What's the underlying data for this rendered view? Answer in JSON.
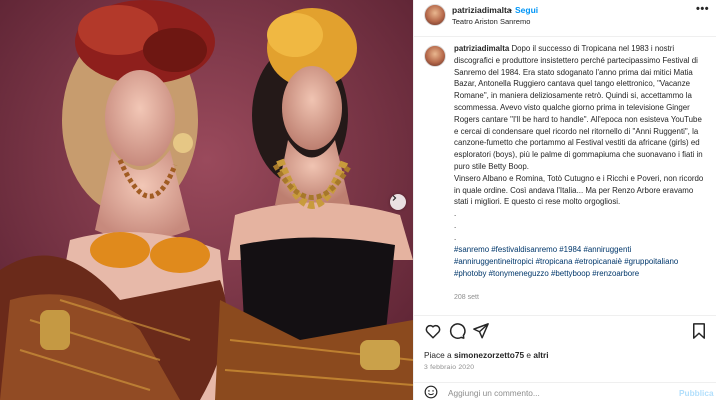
{
  "post": {
    "username": "patriziadimalta",
    "dot": "•",
    "follow_label": "Segui",
    "location": "Teatro Ariston Sanremo",
    "more_icon": "more-horizontal-icon",
    "caption_text": "Dopo il successo di Tropicana nel 1983 i nostri discografici e produttore insistettero perché partecipassimo Festival di Sanremo del 1984. Era stato sdoganato l'anno prima dai mitici Matia Bazar, Antonella Ruggiero cantava quel tango elettronico, \"Vacanze Romane\", in maniera deliziosamente retrò. Quindi si, accettammo la scommessa. Avevo visto qualche giorno prima in televisione Ginger Rogers cantare \"I'll be hard to handle\". All'epoca non esisteva YouTube e cercai di condensare quel ricordo nel ritornello di \"Anni Ruggenti\", la canzone-fumetto che portammo al Festival vestiti da africane (girls) ed esploratori (boys), più le palme di gommapiuma che suonavano i fiati in puro stile Betty Boop.\nVinsero Albano e Romina, Totò Cutugno e i Ricchi e Poveri, non ricordo in quale ordine. Così andava l'Italia... Ma per Renzo Arbore eravamo stati i migliori. E questo ci rese molto orgogliosi.\n.\n.\n.",
    "hashtags": [
      "#sanremo",
      "#festivaldisanremo",
      "#1984",
      "#anniruggenti",
      "#anniruggentineitropici",
      "#tropicana",
      "#etropicanaiè",
      "#gruppoitaliano",
      "#photoby",
      "#tonymeneguzzo",
      "#bettyboop",
      "#renzoarbore"
    ],
    "age": "208 sett",
    "likes_prefix": "Piace a",
    "likes_user": "simonezorzetto75",
    "likes_joiner": "e",
    "likes_others": "altri",
    "date": "3 febbraio 2020",
    "comment_placeholder": "Aggiungi un commento...",
    "publish_label": "Pubblica"
  },
  "icons": {
    "like": "heart-icon",
    "comment": "comment-icon",
    "share": "share-icon",
    "save": "bookmark-icon",
    "emoji": "emoji-icon",
    "next": "chevron-right-icon"
  },
  "colors": {
    "link": "#0095f6",
    "hashtag": "#00376b",
    "muted": "#8e8e8e",
    "border": "#efefef"
  }
}
